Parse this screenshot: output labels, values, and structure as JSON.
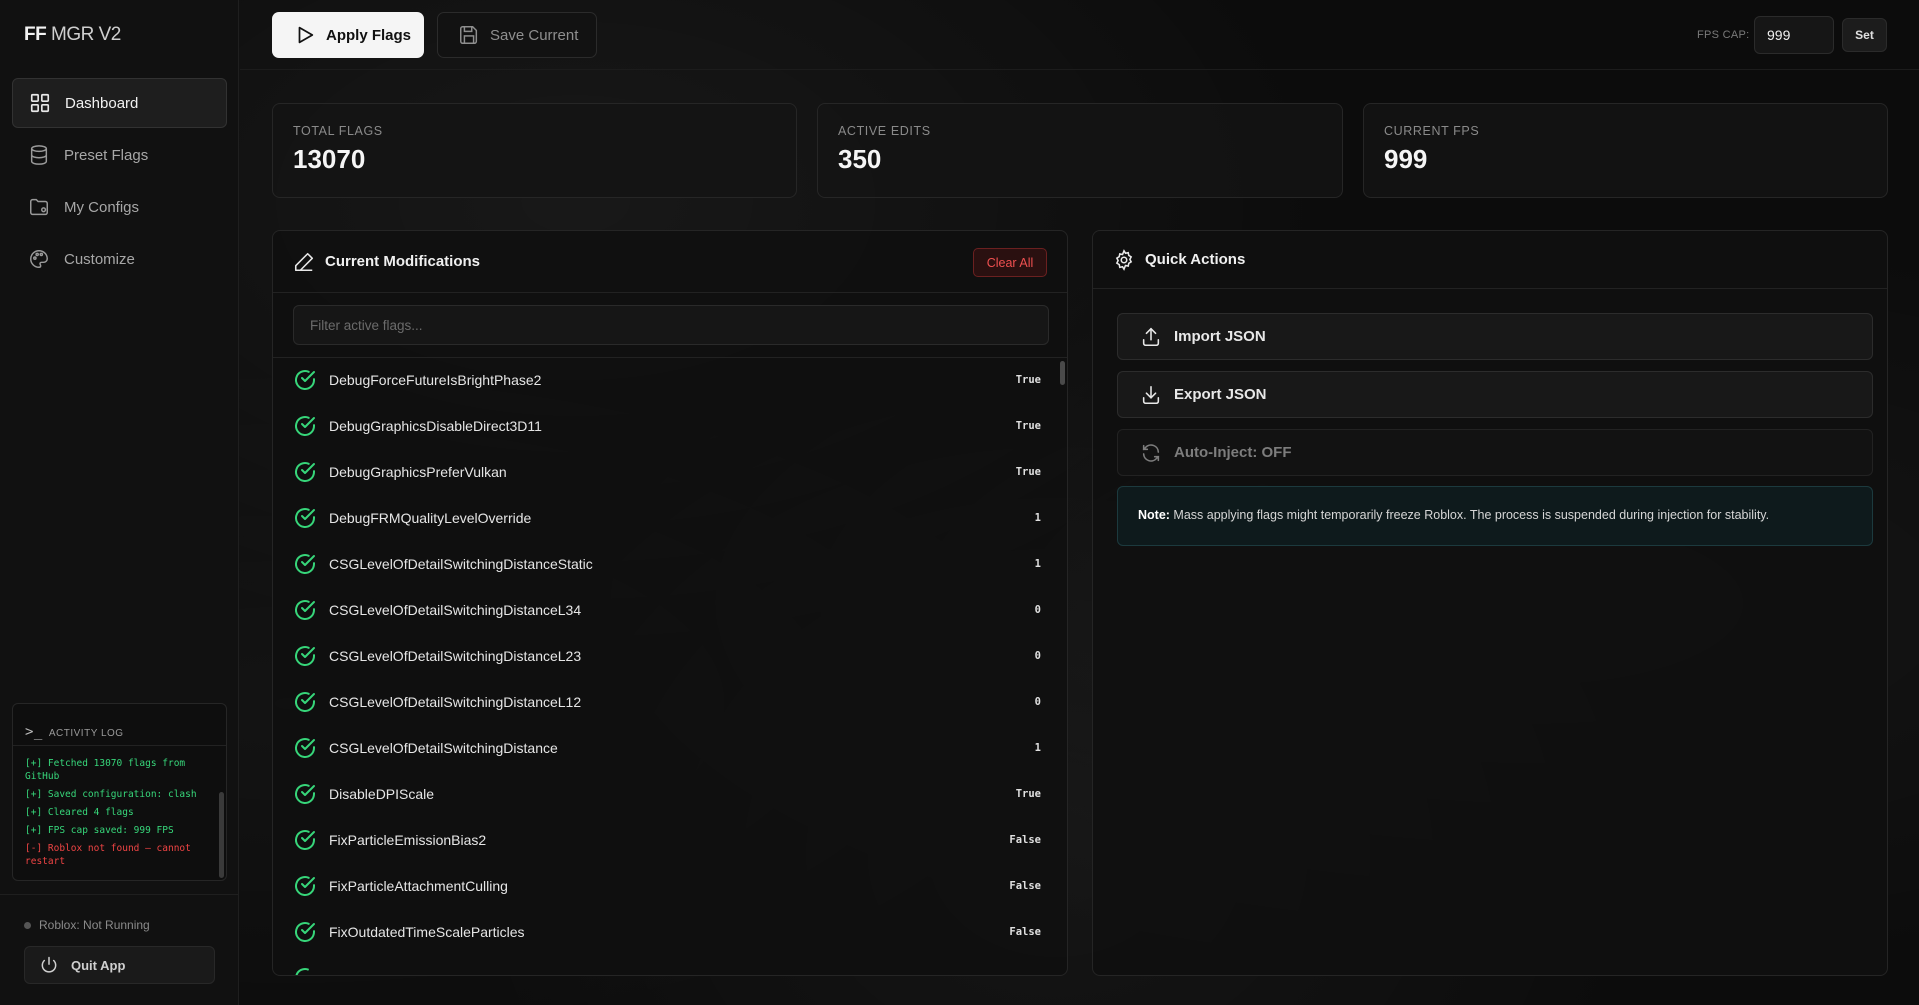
{
  "app": {
    "brand_bold": "FF",
    "brand_rest": " MGR V2"
  },
  "sidebar": {
    "items": [
      {
        "label": "Dashboard",
        "icon": "grid-icon",
        "active": true
      },
      {
        "label": "Preset Flags",
        "icon": "database-icon"
      },
      {
        "label": "My Configs",
        "icon": "folder-icon"
      },
      {
        "label": "Customize",
        "icon": "palette-icon"
      }
    ]
  },
  "activity_log": {
    "title": "ACTIVITY LOG",
    "lines": [
      {
        "text": "[+] Fetched 13070 flags from GitHub",
        "status": "ok"
      },
      {
        "text": "[+] Saved configuration: clash",
        "status": "ok"
      },
      {
        "text": "[+] Cleared 4 flags",
        "status": "ok"
      },
      {
        "text": "[+] FPS cap saved: 999 FPS",
        "status": "ok"
      },
      {
        "text": "[-] Roblox not found — cannot restart",
        "status": "error"
      }
    ]
  },
  "status": {
    "roblox": "Roblox: Not Running",
    "quit_label": "Quit App"
  },
  "toolbar": {
    "apply_label": "Apply Flags",
    "save_label": "Save Current",
    "fps_cap_label": "FPS CAP:",
    "fps_cap_value": "999",
    "set_label": "Set"
  },
  "stats": {
    "total_flags_label": "TOTAL FLAGS",
    "total_flags": "13070",
    "active_edits_label": "ACTIVE EDITS",
    "active_edits": "350",
    "current_fps_label": "CURRENT FPS",
    "current_fps": "999"
  },
  "modifications": {
    "title": "Current Modifications",
    "clear_label": "Clear All",
    "filter_placeholder": "Filter active flags...",
    "flags": [
      {
        "name": "DebugForceFutureIsBrightPhase2",
        "value": "True"
      },
      {
        "name": "DebugGraphicsDisableDirect3D11",
        "value": "True"
      },
      {
        "name": "DebugGraphicsPreferVulkan",
        "value": "True"
      },
      {
        "name": "DebugFRMQualityLevelOverride",
        "value": "1"
      },
      {
        "name": "CSGLevelOfDetailSwitchingDistanceStatic",
        "value": "1"
      },
      {
        "name": "CSGLevelOfDetailSwitchingDistanceL34",
        "value": "0"
      },
      {
        "name": "CSGLevelOfDetailSwitchingDistanceL23",
        "value": "0"
      },
      {
        "name": "CSGLevelOfDetailSwitchingDistanceL12",
        "value": "0"
      },
      {
        "name": "CSGLevelOfDetailSwitchingDistance",
        "value": "1"
      },
      {
        "name": "DisableDPIScale",
        "value": "True"
      },
      {
        "name": "FixParticleEmissionBias2",
        "value": "False"
      },
      {
        "name": "FixParticleAttachmentCulling",
        "value": "False"
      },
      {
        "name": "FixOutdatedTimeScaleParticles",
        "value": "False"
      }
    ]
  },
  "quick_actions": {
    "title": "Quick Actions",
    "import_label": "Import JSON",
    "export_label": "Export JSON",
    "auto_inject_label": "Auto-Inject: OFF",
    "note_bold": "Note:",
    "note_text": " Mass applying flags might temporarily freeze Roblox. The process is suspended during injection for stability."
  },
  "colors": {
    "accent_green": "#37d67a",
    "error_red": "#ef4444"
  }
}
